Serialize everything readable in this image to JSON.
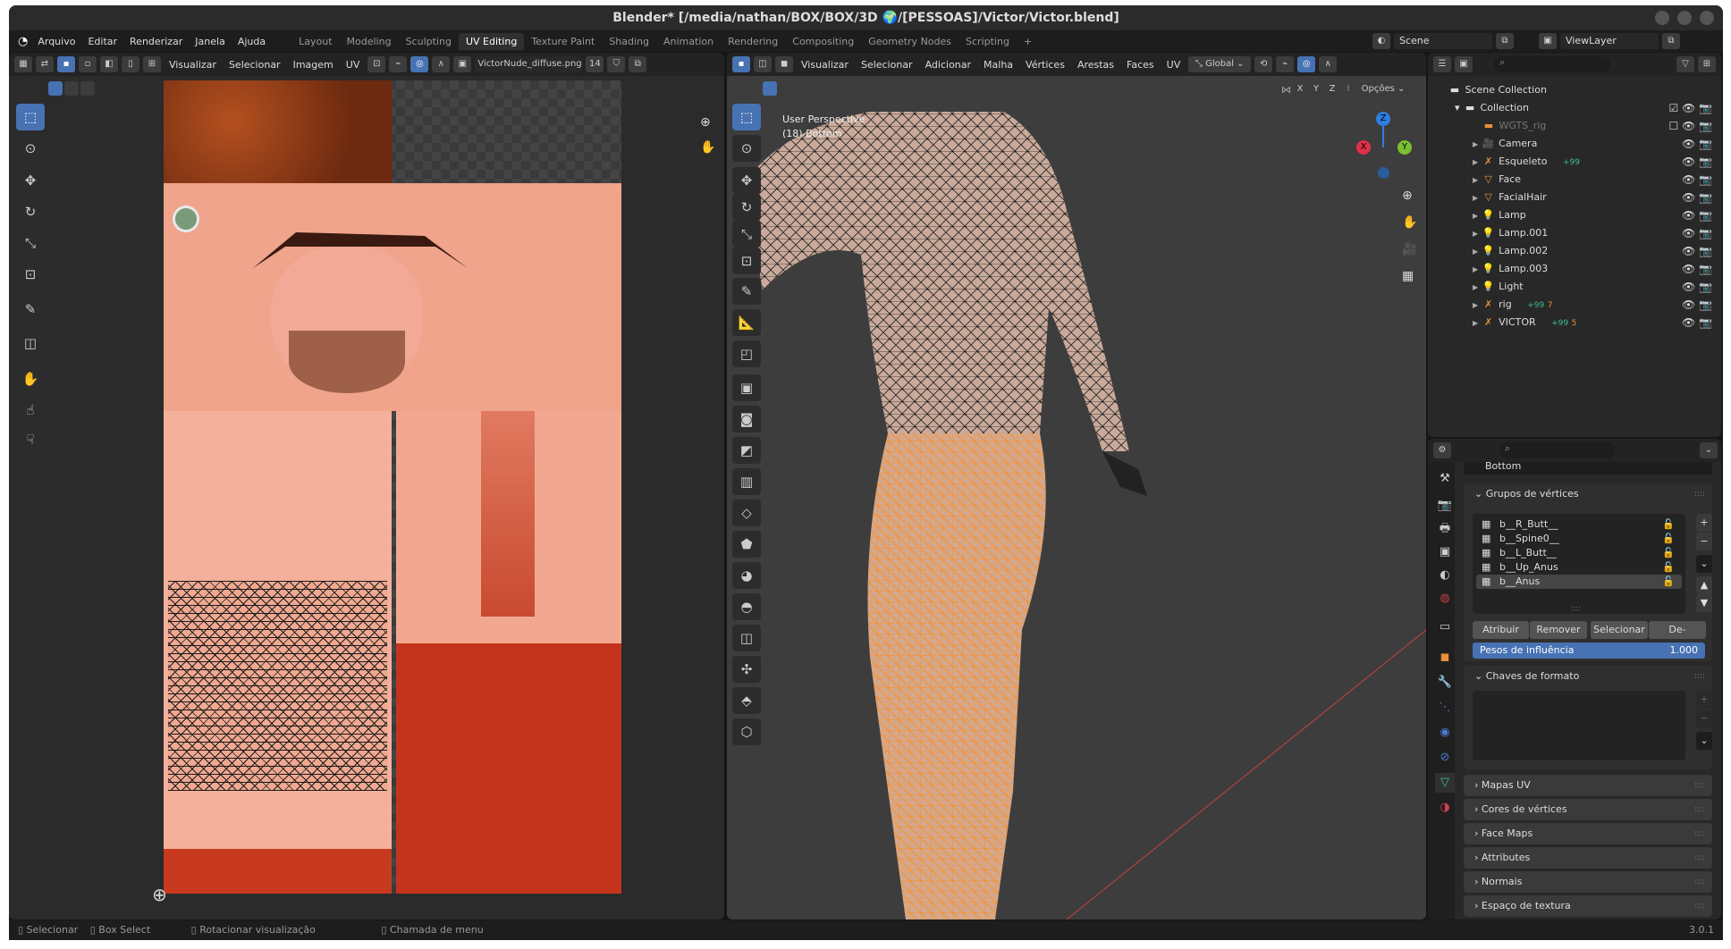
{
  "window": {
    "title": "Blender* [/media/nathan/BOX/BOX/3D 🌍/[PESSOAS]/Victor/Victor.blend]"
  },
  "menu": [
    "Arquivo",
    "Editar",
    "Renderizar",
    "Janela",
    "Ajuda"
  ],
  "workspaces": [
    "Layout",
    "Modeling",
    "Sculpting",
    "UV Editing",
    "Texture Paint",
    "Shading",
    "Animation",
    "Rendering",
    "Compositing",
    "Geometry Nodes",
    "Scripting",
    "+"
  ],
  "active_workspace": "UV Editing",
  "scene": {
    "label": "Scene",
    "view_layer": "ViewLayer"
  },
  "uv_editor": {
    "menus": [
      "Visualizar",
      "Selecionar",
      "Imagem",
      "UV"
    ],
    "image_name": "VictorNude_diffuse.png",
    "image_users": "14"
  },
  "viewport": {
    "menus": [
      "Visualizar",
      "Selecionar",
      "Adicionar",
      "Malha",
      "Vértices",
      "Arestas",
      "Faces",
      "UV"
    ],
    "orientation": "Global",
    "axes": [
      "X",
      "Y",
      "Z"
    ],
    "options_label": "Opções",
    "view_name": "User Perspective",
    "object_info": "(18) Bottom",
    "gizmo": {
      "x": "X",
      "y": "Y",
      "z": "Z"
    }
  },
  "outliner": {
    "root": "Scene Collection",
    "collection": "Collection",
    "items": [
      {
        "name": "WGTS_rig",
        "icon": "collection-icon",
        "dim": true
      },
      {
        "name": "Camera",
        "icon": "camera-icon"
      },
      {
        "name": "Esqueleto",
        "icon": "armature-icon",
        "badge": "+99"
      },
      {
        "name": "Face",
        "icon": "mesh-icon"
      },
      {
        "name": "FacialHair",
        "icon": "mesh-icon"
      },
      {
        "name": "Lamp",
        "icon": "light-icon"
      },
      {
        "name": "Lamp.001",
        "icon": "light-icon"
      },
      {
        "name": "Lamp.002",
        "icon": "light-icon"
      },
      {
        "name": "Lamp.003",
        "icon": "light-icon"
      },
      {
        "name": "Light",
        "icon": "light-icon"
      },
      {
        "name": "rig",
        "icon": "armature-icon",
        "badge": "+99",
        "count": "7"
      },
      {
        "name": "VICTOR",
        "icon": "armature-icon",
        "badge": "+99",
        "count": "5"
      }
    ]
  },
  "properties": {
    "data_name": "Bottom",
    "vertex_groups": {
      "title": "Grupos de vértices",
      "items": [
        "b__R_Butt__",
        "b__Spine0__",
        "b__L_Butt__",
        "b__Up_Anus",
        "b__Anus"
      ],
      "selected": "b__Anus",
      "buttons": [
        "Atribuir",
        "Remover",
        "Selecionar",
        "De-selecio..."
      ],
      "weight_label": "Pesos de influência",
      "weight_value": "1.000"
    },
    "shape_keys_title": "Chaves de formato",
    "collapsed_sections": [
      "Mapas UV",
      "Cores de vértices",
      "Face Maps",
      "Attributes",
      "Normais",
      "Espaço de textura"
    ]
  },
  "status": {
    "hints": [
      "Selecionar",
      "Box Select",
      "Rotacionar visualização",
      "Chamada de menu"
    ],
    "version": "3.0.1"
  },
  "colors": {
    "accent": "#4772b3",
    "selection": "#ff8c1a",
    "background": "#303030"
  }
}
